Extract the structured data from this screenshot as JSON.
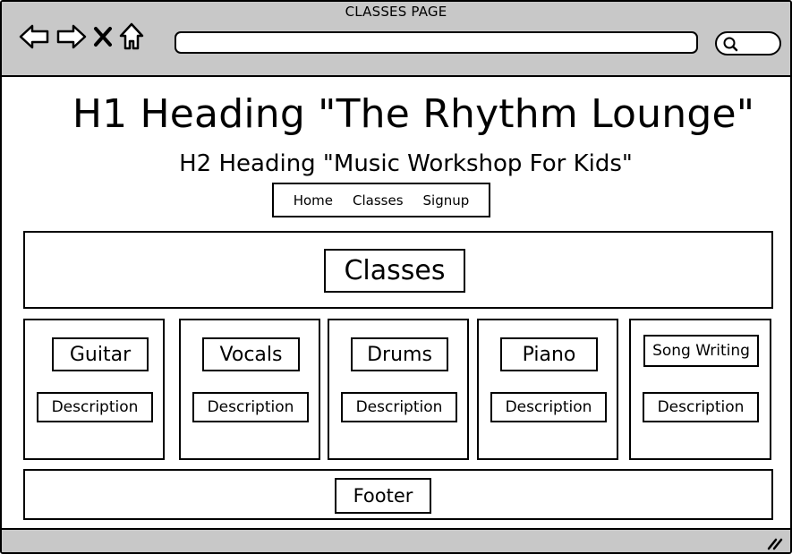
{
  "window": {
    "title": "CLASSES PAGE"
  },
  "toolbar": {
    "icons": [
      "back-arrow-icon",
      "forward-arrow-icon",
      "close-icon",
      "home-icon"
    ],
    "address_value": "",
    "search_icon": "search-icon"
  },
  "header": {
    "h1": "H1 Heading \"The Rhythm Lounge\"",
    "h2": "H2 Heading \"Music Workshop For Kids\""
  },
  "nav": {
    "items": [
      "Home",
      "Classes",
      "Signup"
    ]
  },
  "classes": {
    "title": "Classes",
    "cards": [
      {
        "name": "Guitar",
        "description": "Description"
      },
      {
        "name": "Vocals",
        "description": "Description"
      },
      {
        "name": "Drums",
        "description": "Description"
      },
      {
        "name": "Piano",
        "description": "Description"
      },
      {
        "name": "Song Writing",
        "description": "Description"
      }
    ]
  },
  "footer": {
    "label": "Footer"
  },
  "colors": {
    "chrome": "#c8c8c8",
    "border": "#000000",
    "background": "#ffffff"
  }
}
